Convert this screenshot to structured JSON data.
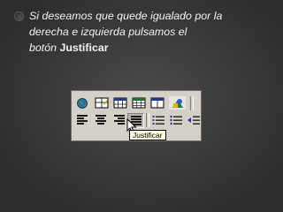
{
  "slide": {
    "text_line1": "Si deseamos que quede igualado por la",
    "text_line2": "derecha e izquierda pulsamos el",
    "text_line3_prefix": "botón ",
    "text_line3_bold": "Justificar"
  },
  "toolbar": {
    "tooltip": "Justificar",
    "row1_icons": [
      "globe-icon",
      "border-table-icon",
      "insert-table-icon",
      "insert-excel-icon",
      "columns-icon",
      "drawing-icon"
    ],
    "row2_icons": [
      "align-left-icon",
      "align-center-icon",
      "align-right-icon",
      "justify-icon",
      "numbering-icon",
      "bullets-icon",
      "decrease-indent-icon"
    ]
  },
  "colors": {
    "background": "#3a3a3a",
    "text": "#f2f2f2",
    "toolbar": "#d4d0c8",
    "tooltip": "#ffffe1"
  }
}
